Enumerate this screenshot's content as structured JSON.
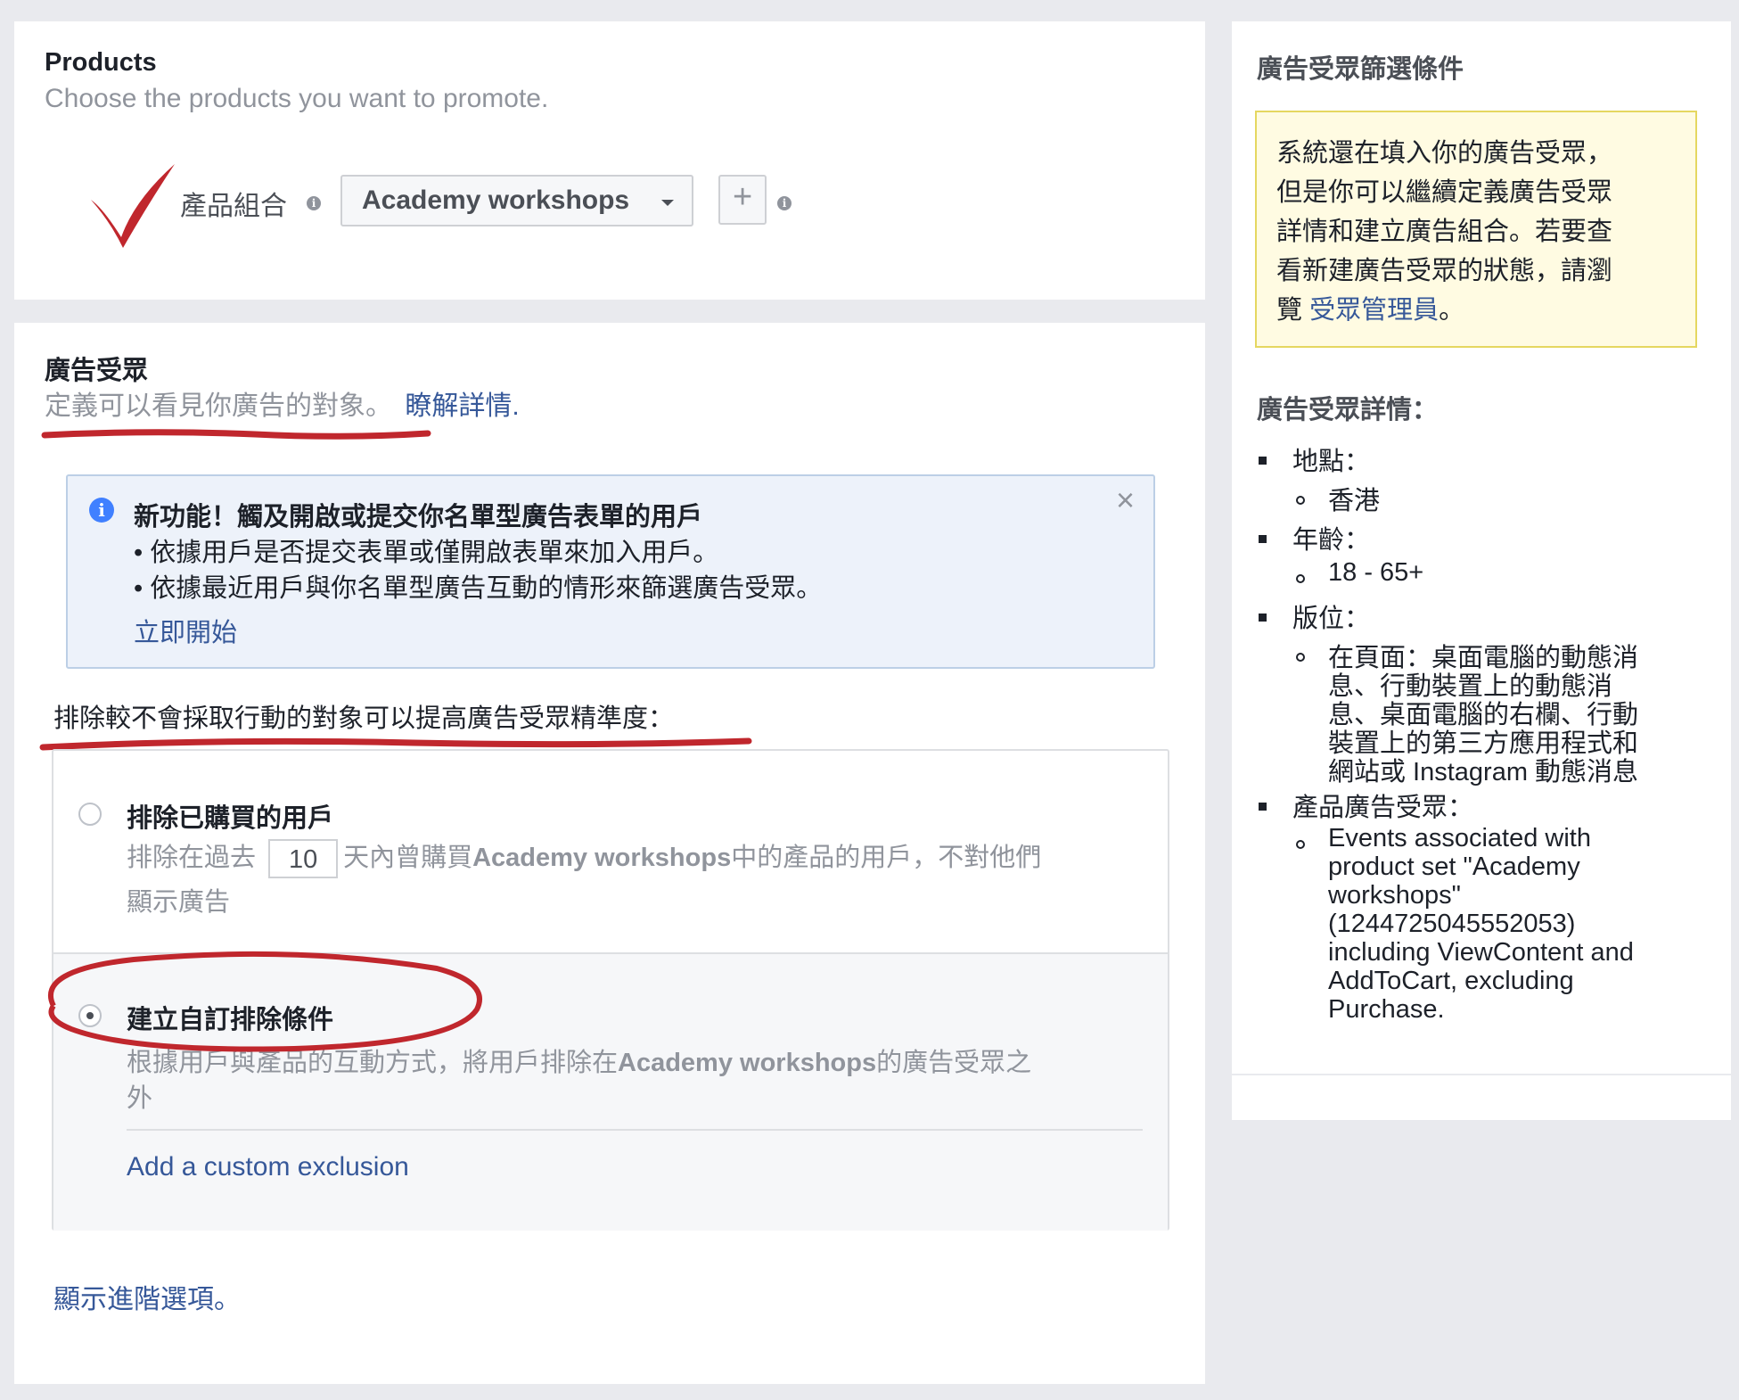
{
  "products": {
    "title": "Products",
    "subtitle": "Choose the products you want to promote.",
    "set_label": "產品組合",
    "set_value": "Academy workshops",
    "add_symbol": "+"
  },
  "audience": {
    "title": "廣告受眾",
    "subtitle": "定義可以看見你廣告的對象。",
    "learn_more": "瞭解詳情."
  },
  "notice": {
    "heading": "新功能！觸及開啟或提交你名單型廣告表單的用戶",
    "bullet1": "• 依據用戶是否提交表單或僅開啟表單來加入用戶。",
    "bullet2": "• 依據最近用戶與你名單型廣告互動的情形來篩選廣告受眾。",
    "action": "立即開始",
    "close": "×"
  },
  "exclude": {
    "prompt": "排除較不會採取行動的對象可以提高廣告受眾精準度：",
    "option1_title": "排除已購買的用戶",
    "option1_pre": "排除在過去",
    "option1_days": "10",
    "option1_post": "天內曾購買",
    "option1_product": "Academy workshops",
    "option1_post2": "中的產品的用戶，不對他們",
    "option1_line2": "顯示廣告",
    "option2_title": "建立自訂排除條件",
    "option2_pre": "根據用戶與產品的互動方式，將用戶排除在",
    "option2_product": "Academy workshops",
    "option2_post": "的廣告受眾之",
    "option2_line2": "外",
    "add_custom": "Add a custom exclusion"
  },
  "advanced_link": "顯示進階選項。",
  "sidebar": {
    "title": "廣告受眾篩選條件",
    "notice_line1": "系統還在填入你的廣告受眾，",
    "notice_line2": "但是你可以繼續定義廣告受眾",
    "notice_line3": "詳情和建立廣告組合。若要查",
    "notice_line4": "看新建廣告受眾的狀態，請瀏",
    "notice_line5_pre": "覽",
    "notice_link": "受眾管理員",
    "notice_line5_post": "。",
    "details_title": "廣告受眾詳情：",
    "location_label": "地點：",
    "location_value": "香港",
    "age_label": "年齡：",
    "age_value": "18 - 65+",
    "placement_label": "版位：",
    "placement_l1": "在頁面：桌面電腦的動態消",
    "placement_l2": "息、行動裝置上的動態消",
    "placement_l3": "息、桌面電腦的右欄、行動",
    "placement_l4": "裝置上的第三方應用程式和",
    "placement_l5": "網站或 Instagram 動態消息",
    "product_audience_label": "產品廣告受眾：",
    "pa_l1": "Events associated with",
    "pa_l2": "product set \"Academy",
    "pa_l3": "workshops\"",
    "pa_l4": "(1244725045552053)",
    "pa_l5": "including ViewContent and",
    "pa_l6": "AddToCart, excluding",
    "pa_l7": "Purchase."
  },
  "colors": {
    "page_bg": "#e9eaee",
    "link": "#365899",
    "muted": "#90949c",
    "annotation_red": "#c0272d",
    "notice_blue_bg": "#edf2fa",
    "warning_yellow_bg": "#fffbe2"
  }
}
